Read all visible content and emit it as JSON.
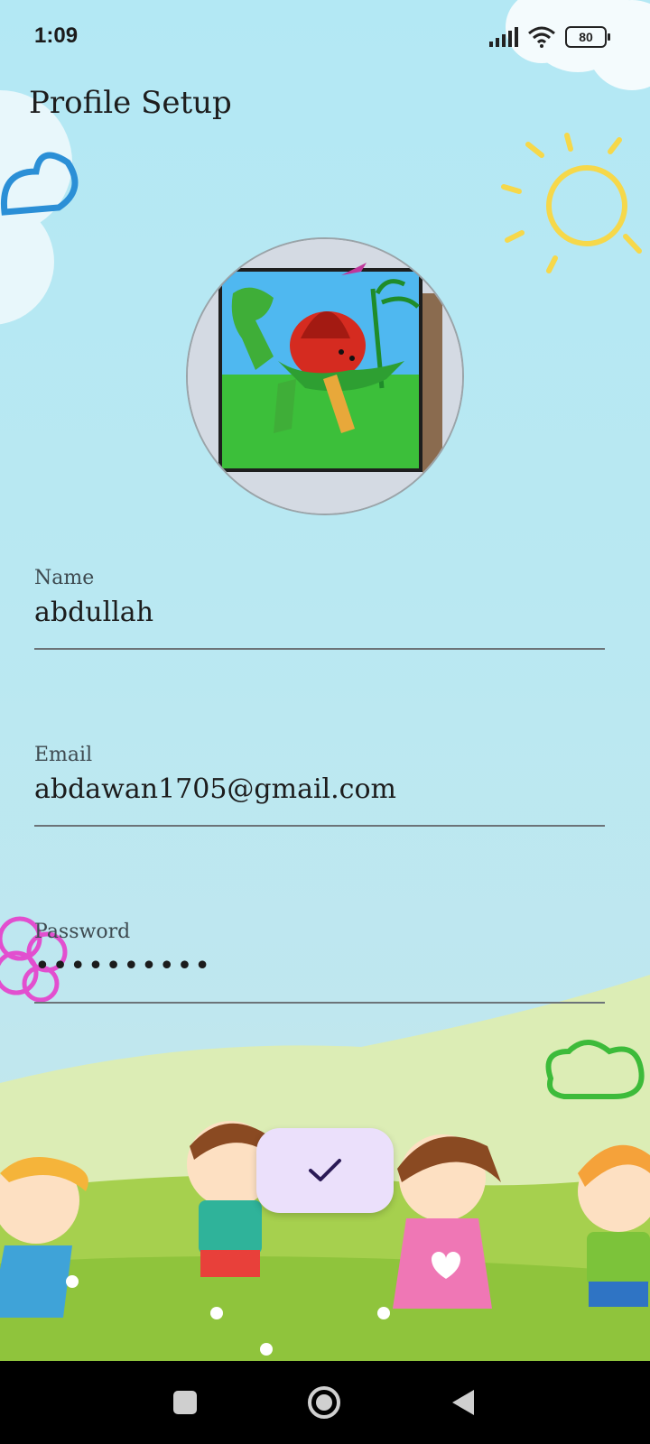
{
  "status_bar": {
    "time": "1:09",
    "battery": "80",
    "icons": [
      "signal-icon",
      "wifi-icon",
      "battery-icon"
    ]
  },
  "app": {
    "title": "Profile Setup"
  },
  "form": {
    "name": {
      "label": "Name",
      "value": "abdullah"
    },
    "email": {
      "label": "Email",
      "value": "abdawan1705@gmail.com"
    },
    "password": {
      "label": "Password",
      "value": "••••••••••"
    }
  },
  "fab": {
    "icon": "check-icon",
    "color": "#2b1a56",
    "background": "#ebe0fb"
  },
  "nav_bar": {
    "icons": [
      "recents-square-icon",
      "home-circle-icon",
      "back-triangle-icon"
    ]
  },
  "colors": {
    "sky": "#b3e8f4",
    "grass": "#9ccc4a",
    "hill": "#d9ebb0",
    "sun": "#f6d84a"
  }
}
